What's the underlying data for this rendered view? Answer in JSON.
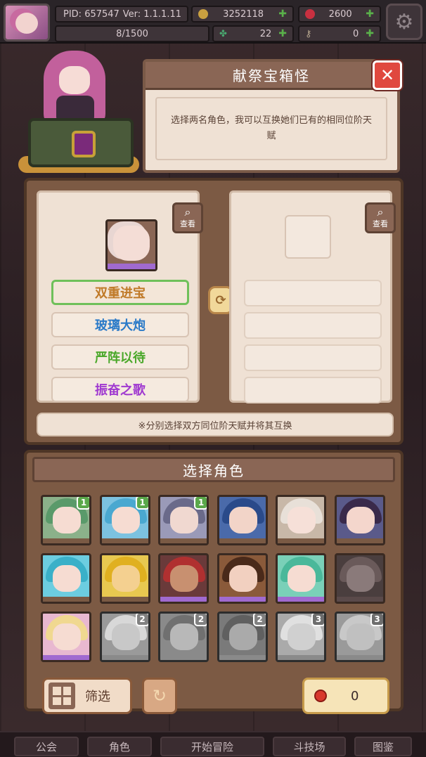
{
  "topbar": {
    "pid": "PID: 657547",
    "version": "Ver: 1.1.1.11",
    "exp": "8/1500",
    "gold": "3252118",
    "gems": "2600",
    "clovers": "22",
    "keys": "0"
  },
  "header": {
    "title": "献祭宝箱怪",
    "description": "选择两名角色，我可以互换她们已有的相同位阶天赋"
  },
  "swap": {
    "view_label": "查看",
    "left_talents": [
      {
        "name": "双重进宝",
        "color": "#c07a28"
      },
      {
        "name": "玻璃大炮",
        "color": "#2a7ac8"
      },
      {
        "name": "严阵以待",
        "color": "#4aa82a"
      },
      {
        "name": "振奋之歌",
        "color": "#a03ad0"
      }
    ],
    "note": "※分别选择双方同位阶天赋并将其互换"
  },
  "pick": {
    "title": "选择角色",
    "characters": [
      {
        "id": "c1",
        "level": "1",
        "hair": "#5a9a6a",
        "bg": "#8bb18a",
        "face": "#f6dcd2",
        "bar": "#7a5a44",
        "badge": "#5aa84a",
        "gray": false
      },
      {
        "id": "c2",
        "level": "1",
        "hair": "#4aa8d0",
        "bg": "#7cc2e0",
        "face": "#f6dcd2",
        "bar": "#7a5a44",
        "badge": "#5aa84a",
        "gray": false
      },
      {
        "id": "c3",
        "level": "1",
        "hair": "#6a6a8a",
        "bg": "#9a9ab8",
        "face": "#f0d8d0",
        "bar": "#7a5a44",
        "badge": "#5aa84a",
        "gray": false
      },
      {
        "id": "c4",
        "level": "",
        "hair": "#2a4a8a",
        "bg": "#4a6aaa",
        "face": "#f2d4c8",
        "bar": "#7a5a44",
        "badge": "",
        "gray": false
      },
      {
        "id": "c5",
        "level": "",
        "hair": "#e8e0d8",
        "bg": "#c8b8a8",
        "face": "#f6e0d8",
        "bar": "#7a5a44",
        "badge": "",
        "gray": false
      },
      {
        "id": "c6",
        "level": "",
        "hair": "#3a2a4a",
        "bg": "#5a5a8a",
        "face": "#f4d6cc",
        "bar": "#7a5a44",
        "badge": "",
        "gray": false
      },
      {
        "id": "c7",
        "level": "",
        "hair": "#3ab0c8",
        "bg": "#6ccde0",
        "face": "#f6dcd2",
        "bar": "#7a5a44",
        "badge": "",
        "gray": false
      },
      {
        "id": "c8",
        "level": "",
        "hair": "#e0b020",
        "bg": "#e8c850",
        "face": "#f4d090",
        "bar": "#7a5a44",
        "badge": "",
        "gray": false
      },
      {
        "id": "c9",
        "level": "",
        "hair": "#b03030",
        "bg": "#6a3a3a",
        "face": "#c89070",
        "bar": "#a06ad0",
        "badge": "",
        "gray": false
      },
      {
        "id": "c10",
        "level": "",
        "hair": "#4a2a1a",
        "bg": "#8a5a3a",
        "face": "#f2d0c0",
        "bar": "#a06ad0",
        "badge": "",
        "gray": false
      },
      {
        "id": "c11",
        "level": "",
        "hair": "#4ab89a",
        "bg": "#7ad0b8",
        "face": "#f6dcd2",
        "bar": "#a06ad0",
        "badge": "",
        "gray": false
      },
      {
        "id": "c12",
        "level": "",
        "hair": "#6a5a5a",
        "bg": "#4a3e3e",
        "face": "#8a7a7a",
        "bar": "#5a4a4a",
        "badge": "",
        "gray": false
      },
      {
        "id": "c13",
        "level": "",
        "hair": "#f0d890",
        "bg": "#e8b8d0",
        "face": "#f6dcd2",
        "bar": "#a06ad0",
        "badge": "",
        "gray": false
      },
      {
        "id": "c14",
        "level": "2",
        "hair": "#d8d8d8",
        "bg": "#9a9a9a",
        "face": "#c8c8c8",
        "bar": "#8a8a8a",
        "badge": "#4a8ad0",
        "gray": true
      },
      {
        "id": "c15",
        "level": "2",
        "hair": "#707070",
        "bg": "#8a8a8a",
        "face": "#b8b8b8",
        "bar": "#8a8a8a",
        "badge": "#4a8ad0",
        "gray": true
      },
      {
        "id": "c16",
        "level": "2",
        "hair": "#606060",
        "bg": "#7a7a7a",
        "face": "#aaaaaa",
        "bar": "#8a8a8a",
        "badge": "#4a8ad0",
        "gray": true
      },
      {
        "id": "c17",
        "level": "3",
        "hair": "#e0e0e0",
        "bg": "#aaaaaa",
        "face": "#d0d0d0",
        "bar": "#8a8a8a",
        "badge": "#8a5ad0",
        "gray": true
      },
      {
        "id": "c18",
        "level": "3",
        "hair": "#c8c8c8",
        "bg": "#9a9a9a",
        "face": "#c0c0c0",
        "bar": "#8a8a8a",
        "badge": "#8a5ad0",
        "gray": true
      }
    ],
    "filter_label": "筛选",
    "cost_value": "0"
  },
  "nav": {
    "items": [
      "公会",
      "角色",
      "开始冒险",
      "斗技场",
      "图鉴"
    ]
  }
}
